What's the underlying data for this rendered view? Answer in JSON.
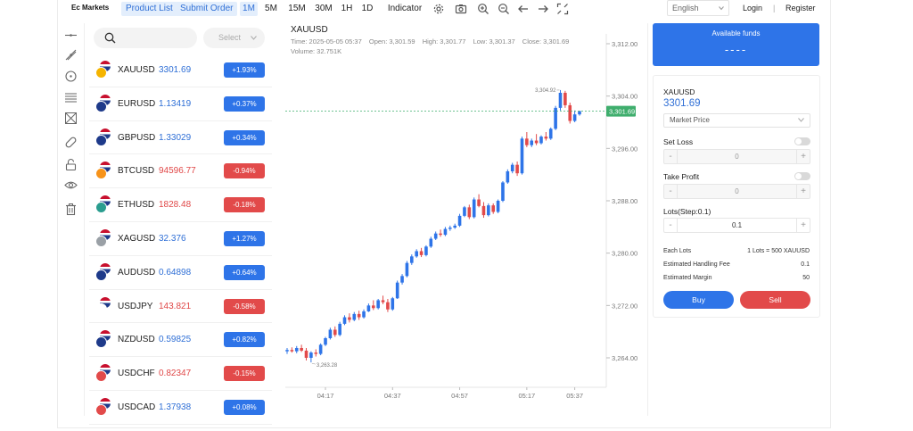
{
  "header": {
    "brand": "Ec Markets",
    "product_list": "Product List",
    "submit_order": "Submit Order",
    "timeframes": [
      "1M",
      "5M",
      "15M",
      "30M",
      "1H",
      "1D"
    ],
    "active_timeframe": "1M",
    "indicator": "Indicator",
    "language": "English",
    "login": "Login",
    "separator": "|",
    "register": "Register"
  },
  "search": {
    "placeholder": "",
    "select_placeholder": "Select"
  },
  "products": [
    {
      "symbol": "XAUUSD",
      "price": "3301.69",
      "change": "+1.93%",
      "dir": "up",
      "c1": "#f5b400",
      "c2": "#2f6fd6"
    },
    {
      "symbol": "EURUSD",
      "price": "1.13419",
      "change": "+0.37%",
      "dir": "up",
      "c1": "#1e3a8a",
      "c2": "#2f6fd6"
    },
    {
      "symbol": "GBPUSD",
      "price": "1.33029",
      "change": "+0.34%",
      "dir": "up",
      "c1": "#1e3a8a",
      "c2": "#c8102e"
    },
    {
      "symbol": "BTCUSD",
      "price": "94596.77",
      "change": "-0.94%",
      "dir": "down",
      "c1": "#f7931a",
      "c2": "#2f6fd6"
    },
    {
      "symbol": "ETHUSD",
      "price": "1828.48",
      "change": "-0.18%",
      "dir": "down",
      "c1": "#2a9d8f",
      "c2": "#2f6fd6"
    },
    {
      "symbol": "XAGUSD",
      "price": "32.376",
      "change": "+1.27%",
      "dir": "up",
      "c1": "#9aa0a6",
      "c2": "#2f6fd6"
    },
    {
      "symbol": "AUDUSD",
      "price": "0.64898",
      "change": "+0.64%",
      "dir": "up",
      "c1": "#1e3a8a",
      "c2": "#2f6fd6"
    },
    {
      "symbol": "USDJPY",
      "price": "143.821",
      "change": "-0.58%",
      "dir": "down",
      "c1": "#ffffff",
      "c2": "#2f6fd6"
    },
    {
      "symbol": "NZDUSD",
      "price": "0.59825",
      "change": "+0.82%",
      "dir": "up",
      "c1": "#1e3a8a",
      "c2": "#2f6fd6"
    },
    {
      "symbol": "USDCHF",
      "price": "0.82347",
      "change": "-0.15%",
      "dir": "down",
      "c1": "#e24a4a",
      "c2": "#2f6fd6"
    },
    {
      "symbol": "USDCAD",
      "price": "1.37938",
      "change": "+0.08%",
      "dir": "up",
      "c1": "#e24a4a",
      "c2": "#2f6fd6"
    }
  ],
  "chart": {
    "symbol": "XAUUSD",
    "time": "Time: 2025-05-05 05:37",
    "open": "Open: 3,301.59",
    "high": "High: 3,301.77",
    "low": "Low: 3,301.37",
    "close": "Close: 3,301.69",
    "volume": "Volume: 32.751K"
  },
  "chart_data": {
    "type": "candlestick",
    "x_ticks": [
      "04:17",
      "04:37",
      "04:57",
      "05:17",
      "05:37"
    ],
    "y_ticks": [
      "3,312.00",
      "3,304.00",
      "3,296.00",
      "3,288.00",
      "3,280.00",
      "3,272.00",
      "3,264.00"
    ],
    "ylim": [
      3259.5,
      3313.5
    ],
    "last_price": "3,301.69",
    "high_annotation": "3,304.92",
    "low_annotation": "3,263.28",
    "up_color": "#2e74e8",
    "down_color": "#e24a4a",
    "candles": [
      [
        3265.0,
        3265.5,
        3264.6,
        3265.2
      ],
      [
        3265.2,
        3265.6,
        3264.8,
        3265.0
      ],
      [
        3265.0,
        3265.8,
        3264.7,
        3265.5
      ],
      [
        3265.5,
        3266.0,
        3264.9,
        3265.1
      ],
      [
        3265.1,
        3265.5,
        3263.6,
        3264.0
      ],
      [
        3264.0,
        3265.0,
        3263.3,
        3264.8
      ],
      [
        3264.8,
        3265.3,
        3264.2,
        3264.6
      ],
      [
        3264.6,
        3266.2,
        3264.4,
        3266.0
      ],
      [
        3266.0,
        3267.2,
        3265.8,
        3267.0
      ],
      [
        3267.0,
        3268.6,
        3266.8,
        3268.3
      ],
      [
        3268.3,
        3268.8,
        3267.2,
        3267.5
      ],
      [
        3267.5,
        3269.5,
        3267.3,
        3269.2
      ],
      [
        3269.2,
        3270.5,
        3269.0,
        3270.2
      ],
      [
        3270.2,
        3270.8,
        3269.4,
        3269.8
      ],
      [
        3269.8,
        3271.0,
        3269.6,
        3270.7
      ],
      [
        3270.7,
        3271.2,
        3269.8,
        3270.2
      ],
      [
        3270.2,
        3271.4,
        3270.0,
        3271.1
      ],
      [
        3271.1,
        3272.3,
        3271.0,
        3272.0
      ],
      [
        3272.0,
        3272.8,
        3271.3,
        3271.6
      ],
      [
        3271.6,
        3273.0,
        3271.4,
        3272.8
      ],
      [
        3272.8,
        3273.5,
        3272.2,
        3272.5
      ],
      [
        3272.5,
        3273.0,
        3271.0,
        3271.4
      ],
      [
        3271.4,
        3273.3,
        3271.2,
        3273.1
      ],
      [
        3273.1,
        3275.8,
        3273.0,
        3275.5
      ],
      [
        3275.5,
        3276.8,
        3275.2,
        3276.5
      ],
      [
        3276.5,
        3278.8,
        3276.3,
        3278.5
      ],
      [
        3278.5,
        3279.8,
        3278.2,
        3279.5
      ],
      [
        3279.5,
        3280.6,
        3279.3,
        3280.3
      ],
      [
        3280.3,
        3280.8,
        3279.4,
        3279.7
      ],
      [
        3279.7,
        3281.2,
        3279.5,
        3281.0
      ],
      [
        3281.0,
        3282.5,
        3280.8,
        3282.2
      ],
      [
        3282.2,
        3283.3,
        3282.0,
        3283.0
      ],
      [
        3283.0,
        3283.6,
        3282.5,
        3282.8
      ],
      [
        3282.8,
        3284.0,
        3282.6,
        3283.7
      ],
      [
        3283.7,
        3284.2,
        3283.4,
        3283.9
      ],
      [
        3283.9,
        3284.5,
        3283.7,
        3284.2
      ],
      [
        3284.2,
        3286.0,
        3284.0,
        3285.7
      ],
      [
        3285.7,
        3287.2,
        3285.5,
        3287.0
      ],
      [
        3287.0,
        3287.4,
        3285.2,
        3285.5
      ],
      [
        3285.5,
        3288.5,
        3285.3,
        3288.2
      ],
      [
        3288.2,
        3289.0,
        3287.0,
        3287.2
      ],
      [
        3287.2,
        3287.8,
        3285.4,
        3285.8
      ],
      [
        3285.8,
        3287.6,
        3285.6,
        3287.3
      ],
      [
        3287.3,
        3287.6,
        3286.0,
        3286.3
      ],
      [
        3286.3,
        3288.2,
        3286.1,
        3288.0
      ],
      [
        3288.0,
        3291.0,
        3287.8,
        3290.8
      ],
      [
        3290.8,
        3292.8,
        3290.6,
        3292.5
      ],
      [
        3292.5,
        3293.8,
        3292.2,
        3293.5
      ],
      [
        3293.5,
        3294.0,
        3291.8,
        3292.2
      ],
      [
        3292.2,
        3297.8,
        3292.0,
        3297.5
      ],
      [
        3297.5,
        3298.5,
        3296.2,
        3296.5
      ],
      [
        3296.5,
        3297.5,
        3296.2,
        3297.2
      ],
      [
        3297.2,
        3298.2,
        3296.5,
        3296.8
      ],
      [
        3296.8,
        3298.0,
        3296.6,
        3297.8
      ],
      [
        3297.8,
        3298.5,
        3297.2,
        3297.5
      ],
      [
        3297.5,
        3299.2,
        3297.3,
        3299.0
      ],
      [
        3299.0,
        3302.5,
        3298.8,
        3302.2
      ],
      [
        3302.2,
        3304.92,
        3301.8,
        3304.5
      ],
      [
        3304.5,
        3304.8,
        3302.2,
        3302.6
      ],
      [
        3302.6,
        3303.0,
        3299.8,
        3300.2
      ],
      [
        3300.2,
        3301.8,
        3300.0,
        3301.2
      ],
      [
        3301.2,
        3301.77,
        3301.0,
        3301.69
      ]
    ]
  },
  "order_panel": {
    "funds_label": "Available funds",
    "funds_value": "----",
    "symbol": "XAUUSD",
    "price": "3301.69",
    "order_type": "Market Price",
    "set_loss": "Set Loss",
    "set_loss_value": "0",
    "take_profit": "Take Profit",
    "take_profit_value": "0",
    "lots_label": "Lots(Step:0.1)",
    "lots_value": "0.1",
    "minus": "-",
    "plus": "+",
    "each_lots_label": "Each Lots",
    "each_lots_value": "1 Lots = 500 XAUUSD",
    "fee_label": "Estimated Handling Fee",
    "fee_value": "0.1",
    "margin_label": "Estimated Margin",
    "margin_value": "50",
    "buy": "Buy",
    "sell": "Sell"
  }
}
